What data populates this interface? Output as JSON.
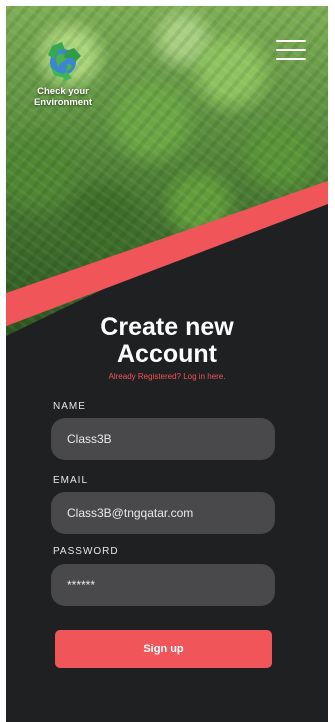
{
  "brand": {
    "name": "Check your Environment",
    "logo_icon": "recycle-globe-icon"
  },
  "menu": {
    "icon": "hamburger-menu-icon"
  },
  "form": {
    "title": "Create new Account",
    "login_link": "Already Registered? Log in here.",
    "name_label": "NAME",
    "name_value": "Class3B",
    "email_label": "EMAIL",
    "email_value": "Class3B@tngqatar.com",
    "password_label": "PASSWORD",
    "password_value": "******",
    "submit_label": "Sign up"
  },
  "colors": {
    "accent": "#f0555a",
    "background": "#1f2022",
    "field": "#49494b"
  }
}
